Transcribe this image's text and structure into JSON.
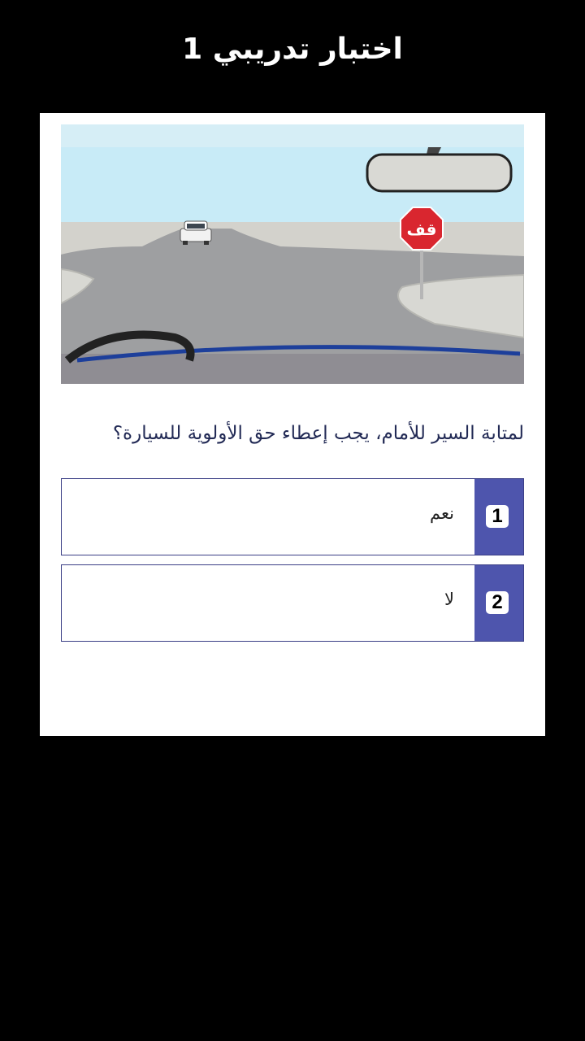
{
  "header": {
    "title": "اختبار تدريبي 1"
  },
  "scene": {
    "stop_sign_text": "قف"
  },
  "question": {
    "text": "لمتابة السير للأمام، يجب إعطاء حق الأولوية للسيارة؟"
  },
  "options": [
    {
      "number": "1",
      "label": "نعم"
    },
    {
      "number": "2",
      "label": "لا"
    }
  ],
  "colors": {
    "background": "#000000",
    "card": "#ffffff",
    "accent": "#4e55ad",
    "option_border": "#3b3f86",
    "question_text": "#222a55"
  }
}
